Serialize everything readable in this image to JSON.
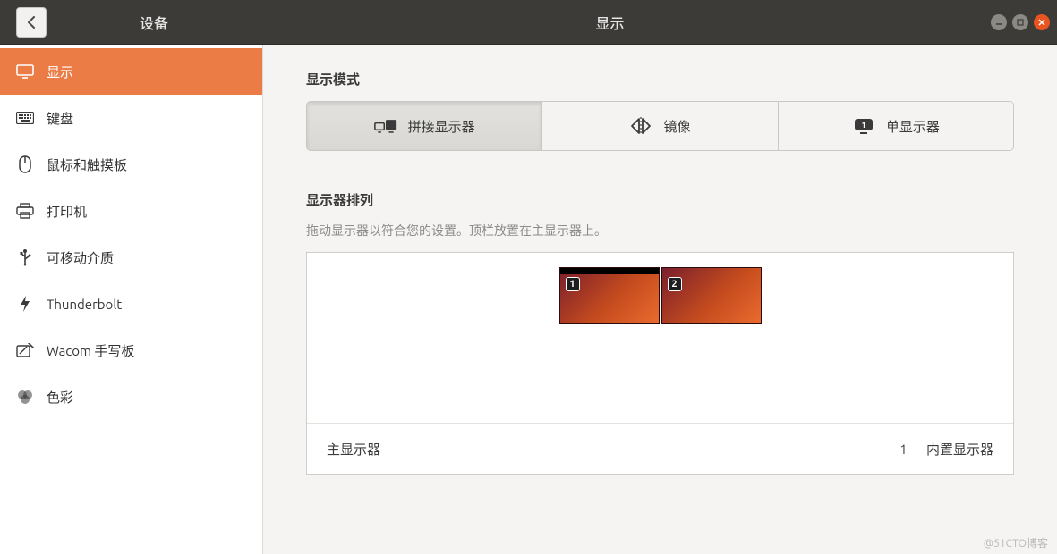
{
  "header": {
    "sidebar_title": "设备",
    "page_title": "显示"
  },
  "sidebar": {
    "items": [
      {
        "icon": "display-icon",
        "label": "显示",
        "active": true
      },
      {
        "icon": "keyboard-icon",
        "label": "键盘",
        "active": false
      },
      {
        "icon": "mouse-icon",
        "label": "鼠标和触摸板",
        "active": false
      },
      {
        "icon": "printer-icon",
        "label": "打印机",
        "active": false
      },
      {
        "icon": "usb-icon",
        "label": "可移动介质",
        "active": false
      },
      {
        "icon": "thunderbolt-icon",
        "label": "Thunderbolt",
        "active": false
      },
      {
        "icon": "tablet-icon",
        "label": "Wacom 手写板",
        "active": false
      },
      {
        "icon": "color-icon",
        "label": "色彩",
        "active": false
      }
    ]
  },
  "main": {
    "mode_section_title": "显示模式",
    "modes": [
      {
        "icon": "join-displays-icon",
        "label": "拼接显示器",
        "selected": true
      },
      {
        "icon": "mirror-icon",
        "label": "镜像",
        "selected": false
      },
      {
        "icon": "single-display-icon",
        "label": "单显示器",
        "selected": false
      }
    ],
    "arrangement_section_title": "显示器排列",
    "arrangement_help": "拖动显示器以符合您的设置。顶栏放置在主显示器上。",
    "monitors": [
      {
        "number": "1",
        "primary": true
      },
      {
        "number": "2",
        "primary": false
      }
    ],
    "primary_label": "主显示器",
    "primary_value_index": "1",
    "primary_value_name": "内置显示器"
  },
  "watermark": "@51CTO博客",
  "colors": {
    "accent": "#ec7c45",
    "header_bg": "#3c3b37"
  }
}
